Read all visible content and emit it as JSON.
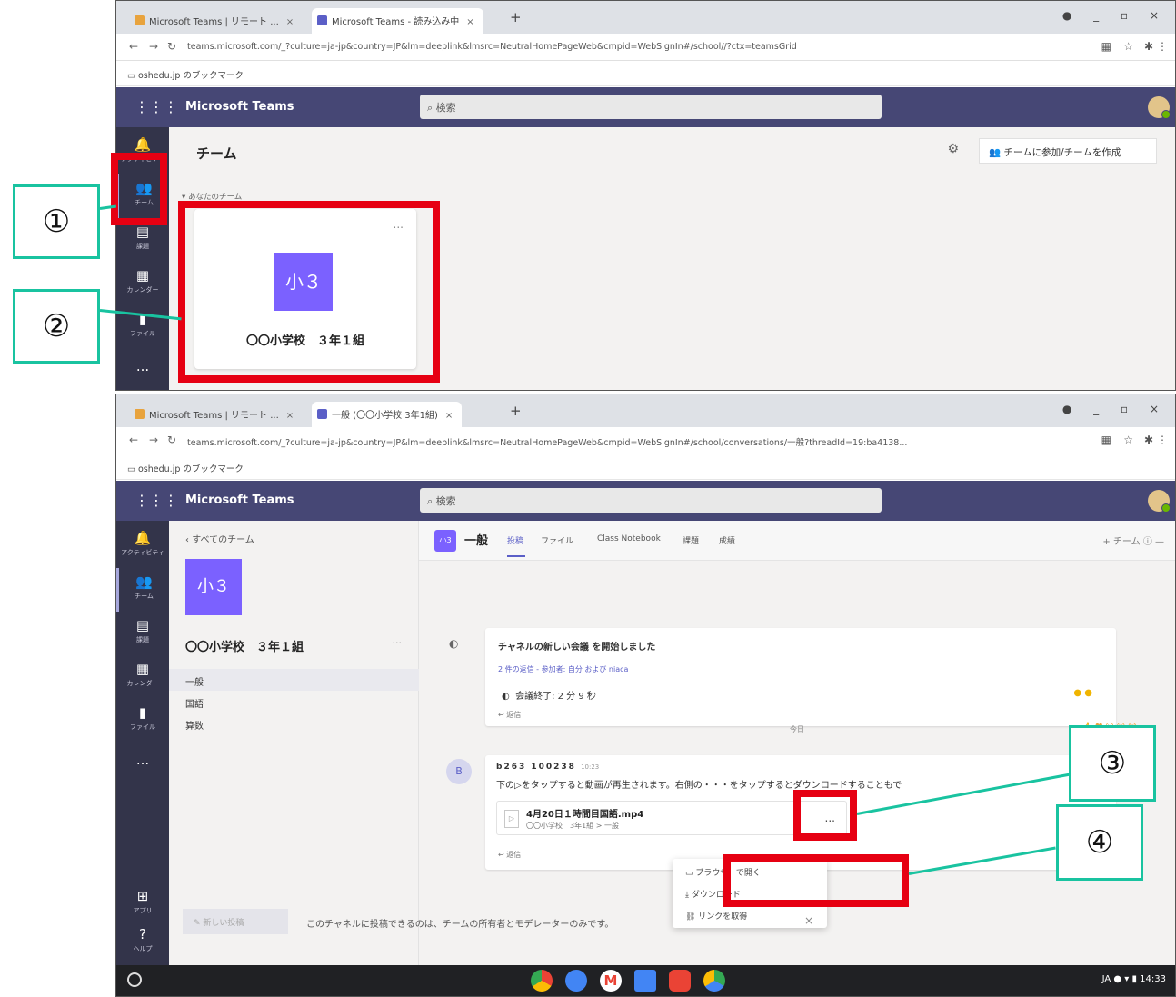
{
  "browser": {
    "tab_site_title": "Microsoft Teams | リモート ...",
    "tab1_title": "Microsoft Teams - 読み込み中",
    "tab2_title": "一般 (〇〇小学校 3年1組)",
    "url1": "teams.microsoft.com/_?culture=ja-jp&country=JP&lm=deeplink&lmsrc=NeutralHomePageWeb&cmpid=WebSignIn#/school//?ctx=teamsGrid",
    "url2": "teams.microsoft.com/_?culture=ja-jp&country=JP&lm=deeplink&lmsrc=NeutralHomePageWeb&cmpid=WebSignIn#/school/conversations/一般?threadId=19:ba4138...",
    "url_domain": "teams.microsoft.com",
    "bookmarks": "oshedu.jp のブックマーク"
  },
  "teams": {
    "app_title": "Microsoft Teams",
    "search_placeholder": "検索"
  },
  "rail": {
    "activity": "アクティビティ",
    "teams": "チーム",
    "assignments": "課題",
    "calendar": "カレンダー",
    "files": "ファイル",
    "more": "...",
    "apps": "アプリ",
    "help": "ヘルプ"
  },
  "screen1": {
    "page_title": "チーム",
    "join_button": "チームに参加/チームを作成",
    "your_teams": "▾ あなたのチーム",
    "team_card_initials": "小３",
    "team_card_name": "〇〇小学校　３年１組",
    "card_more": "..."
  },
  "screen2": {
    "back_label": "すべてのチーム",
    "team_initials": "小３",
    "team_name": "〇〇小学校　３年１組",
    "channels": [
      "一般",
      "国語",
      "算数"
    ],
    "channel_name": "一般",
    "channel_tabs": [
      "投稿",
      "ファイル",
      "Class Notebook",
      "課題",
      "成績"
    ],
    "channel_right": "+ チーム",
    "meeting_started": "チャネルの新しい会議 を開始しました",
    "meeting_participants": "2 件の返信 - 参加者: 自分 および niaca",
    "meeting_ended": "会議終了: 2 分 9 秒",
    "reply": "返信",
    "date_separator": "今日",
    "sender": "b263 100238",
    "sender_time": "10:23",
    "message": "下の▷をタップすると動画が再生されます。右側の・・・をタップするとダウンロードすることもで",
    "file_name": "4月20日１時間目国語.mp4",
    "file_path": "〇〇小学校　3年1組 > 一般",
    "file_more": "...",
    "menu_items": [
      "ブラウザーで開く",
      "ダウンロード",
      "リンクを取得"
    ],
    "new_post": "新しい投稿",
    "compose_notice": "このチャネルに投稿できるのは、チームの所有者とモデレーターのみです。",
    "status_locale": "JA",
    "status_time": "14:33"
  },
  "callouts": [
    "①",
    "②",
    "③",
    "④"
  ],
  "colors": {
    "teams_header": "#464775",
    "rail": "#33344a",
    "team_avatar": "#7b61ff",
    "callout_red": "#e60012",
    "callout_teal": "#19c3a0"
  }
}
